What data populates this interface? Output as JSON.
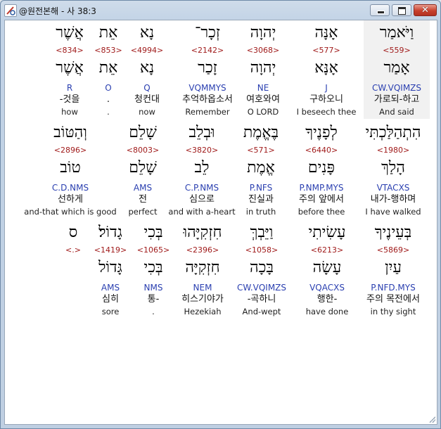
{
  "window": {
    "title": "@원전본해 - 사 38:3",
    "buttons": {
      "minimize": "minimize",
      "maximize": "maximize",
      "close": "✕"
    }
  },
  "rows": [
    {
      "words": [
        {
          "hebrew": "וַיֹּאמַר",
          "strong": "<559>",
          "lemma": "אָמַר",
          "morph": "CW.VQIMZS",
          "korean": "가로되-하고",
          "english": "And said",
          "highlight": true
        },
        {
          "hebrew": "אָנָּה",
          "strong": "<577>",
          "lemma": "אָנָּא",
          "morph": "J",
          "korean": "구하오니",
          "english": "I beseech thee"
        },
        {
          "hebrew": "יְהוָה",
          "strong": "<3068>",
          "lemma": "יְהוָה",
          "morph": "NE",
          "korean": "여호와여",
          "english": "O LORD"
        },
        {
          "hebrew": "זְכָר־",
          "strong": "<2142>",
          "lemma": "זָכַר",
          "morph": "VQMMYS",
          "korean": "추억하옵소서",
          "english": "Remember"
        },
        {
          "hebrew": "נָא",
          "strong": "<4994>",
          "lemma": "נָא",
          "morph": "Q",
          "korean": "청컨대",
          "english": "now"
        },
        {
          "hebrew": "אֵת",
          "strong": "<853>",
          "lemma": "אֵת",
          "morph": "O",
          "korean": ".",
          "english": "."
        },
        {
          "hebrew": "אֲשֶׁר",
          "strong": "<834>",
          "lemma": "אֲשֶׁר",
          "morph": "R",
          "korean": "-것을",
          "english": "how"
        }
      ]
    },
    {
      "words": [
        {
          "hebrew": "הִתְהַלַּכְתִּי",
          "strong": "<1980>",
          "lemma": "הָלַךְ",
          "morph": "VTACXS",
          "korean": "내가-행하며",
          "english": "I have walked"
        },
        {
          "hebrew": "לְפָנֶיךָ",
          "strong": "<6440>",
          "lemma": "פָּנִים",
          "morph": "P.NMP.MYS",
          "korean": "주의 앞에서",
          "english": "before thee"
        },
        {
          "hebrew": "בֶּאֱמֶת",
          "strong": "<571>",
          "lemma": "אֱמֶת",
          "morph": "P.NFS",
          "korean": "진실과",
          "english": "in truth"
        },
        {
          "hebrew": "וּבְלֵב",
          "strong": "<3820>",
          "lemma": "לֵב",
          "morph": "C.P.NMS",
          "korean": "심으로",
          "english": "and with a-heart"
        },
        {
          "hebrew": "שָׁלֵם",
          "strong": "<8003>",
          "lemma": "שָׁלֵם",
          "morph": "AMS",
          "korean": "전",
          "english": "perfect"
        },
        {
          "hebrew": "וְהַטּוֹב",
          "strong": "<2896>",
          "lemma": "טוֹב",
          "morph": "C.D.NMS",
          "korean": "선하게",
          "english": "and-that which is good"
        }
      ]
    },
    {
      "words": [
        {
          "hebrew": "בְּעֵינֶיךָ",
          "strong": "<5869>",
          "lemma": "עַיִן",
          "morph": "P.NFD.MYS",
          "korean": "주의 목전에서",
          "english": "in thy sight"
        },
        {
          "hebrew": "עָשִׂיתִי",
          "strong": "<6213>",
          "lemma": "עָשָׂה",
          "morph": "VQACXS",
          "korean": "행한-",
          "english": "have done"
        },
        {
          "hebrew": "וַיֵּבְךְּ",
          "strong": "<1058>",
          "lemma": "בָּכָה",
          "morph": "CW.VQIMZS",
          "korean": "-곡하니",
          "english": "And-wept"
        },
        {
          "hebrew": "חִזְקִיָּהוּ",
          "strong": "<2396>",
          "lemma": "חִזְקִיָּה",
          "morph": "NEM",
          "korean": "히스기야가",
          "english": "Hezekiah"
        },
        {
          "hebrew": "בְּכִי",
          "strong": "<1065>",
          "lemma": "בְּכִי",
          "morph": "NMS",
          "korean": "통-",
          "english": "."
        },
        {
          "hebrew": "גָדוֹל׃",
          "strong": "<1419>",
          "lemma": "גָּדוֹל",
          "morph": "AMS",
          "korean": "심히",
          "english": "sore"
        },
        {
          "hebrew": "ס",
          "strong": "<.>",
          "lemma": "",
          "morph": "",
          "korean": "",
          "english": ""
        }
      ]
    }
  ]
}
